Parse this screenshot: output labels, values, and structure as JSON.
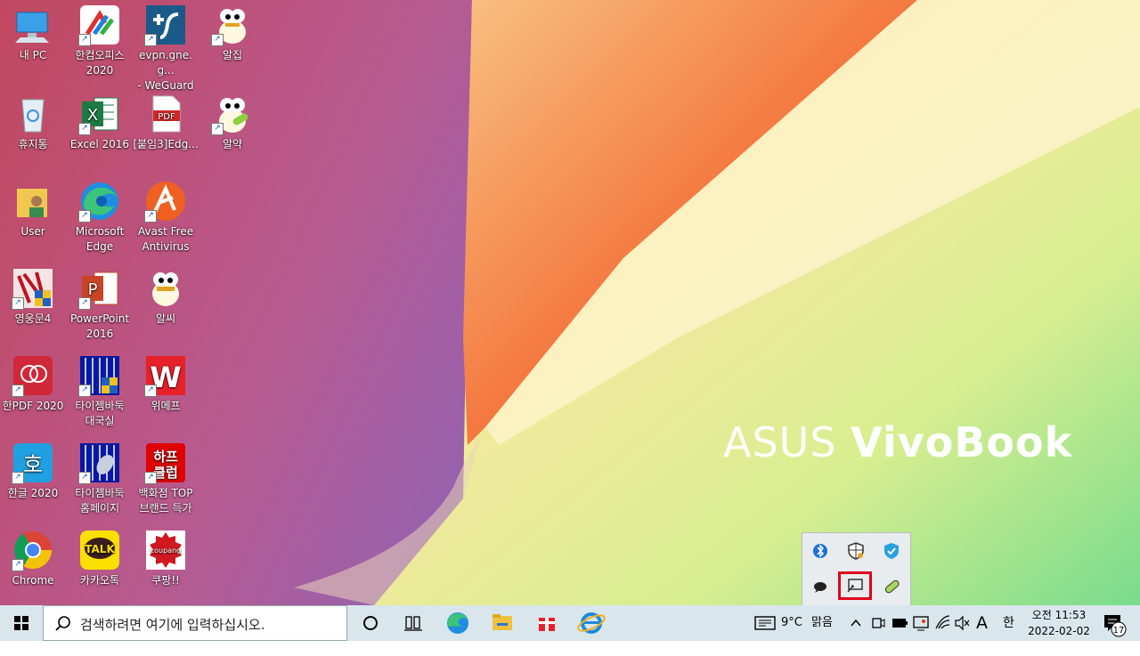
{
  "wallpaper": {
    "brand_light": "ASUS",
    "brand_bold": "VivoBook"
  },
  "desktop_icons": [
    {
      "label": "내 PC",
      "icon": "computer-icon"
    },
    {
      "label": "한컴오피스\n2020",
      "icon": "hancom-office-icon"
    },
    {
      "label": "evpn.gne.g...\n- WeGuardi...",
      "icon": "vpn-icon"
    },
    {
      "label": "알집",
      "icon": "alzip-icon"
    },
    {
      "label": "휴지통",
      "icon": "recycle-bin-icon"
    },
    {
      "label": "Excel 2016",
      "icon": "excel-icon"
    },
    {
      "label": "[붙임3]Edg...",
      "icon": "pdf-file-icon"
    },
    {
      "label": "알약",
      "icon": "alyac-icon"
    },
    {
      "label": "User",
      "icon": "user-folder-icon"
    },
    {
      "label": "Microsoft\nEdge",
      "icon": "edge-icon"
    },
    {
      "label": "Avast Free\nAntivirus",
      "icon": "avast-icon"
    },
    {
      "label": "영웅문4",
      "icon": "youngwoongmun-icon"
    },
    {
      "label": "PowerPoint\n2016",
      "icon": "powerpoint-icon"
    },
    {
      "label": "알씨",
      "icon": "alsee-icon"
    },
    {
      "label": "한PDF 2020",
      "icon": "hanpdf-icon"
    },
    {
      "label": "타이젬바둑\n대국실",
      "icon": "tygem-icon"
    },
    {
      "label": "위메프",
      "icon": "wemakeprice-icon"
    },
    {
      "label": "한글 2020",
      "icon": "hangul-icon"
    },
    {
      "label": "타이젬바둑\n홈페이지",
      "icon": "tygem-home-icon"
    },
    {
      "label": "백화점 TOP\n브랜드 득가",
      "icon": "half-club-icon"
    },
    {
      "label": "Chrome",
      "icon": "chrome-icon"
    },
    {
      "label": "카카오톡",
      "icon": "kakaotalk-icon"
    },
    {
      "label": "쿠팡!!",
      "icon": "coupang-icon"
    }
  ],
  "half_club_text": [
    "하프",
    "클럽"
  ],
  "kakao_text": "TALK",
  "coupang_text": "coupang",
  "pdf_text": "PDF",
  "excel_text": "X",
  "ppt_text": "P",
  "hangul_text": "호",
  "wemakeprice_text": "W",
  "tray_popup": {
    "icons": [
      "bluetooth-icon",
      "security-shield-icon",
      "antivirus-shield-icon",
      "chat-icon",
      "display-projection-icon",
      "pill-icon"
    ]
  },
  "taskbar": {
    "search_placeholder": "검색하려면 여기에 입력하십시오.",
    "pinned": [
      "cortana-icon",
      "task-view-icon",
      "edge-icon",
      "file-explorer-icon",
      "gift-icon",
      "internet-explorer-icon"
    ],
    "weather_temp": "9°C",
    "weather_desc": "맑음",
    "ime_a": "A",
    "ime_han": "한",
    "time_line": "오전 11:53",
    "date_line": "2022-02-02",
    "notification_count": "17"
  },
  "colors": {
    "taskbar_bg": "#d9e6ec",
    "highlight": "#e0001b"
  }
}
